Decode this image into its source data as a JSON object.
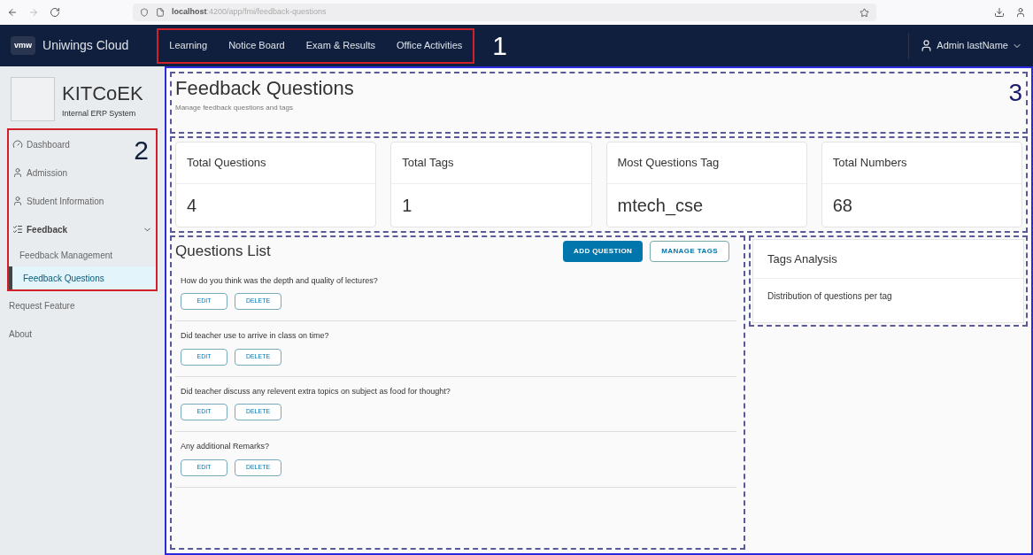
{
  "browser": {
    "url_host": "localhost",
    "url_path": ":4200/app/fmi/feedback-questions"
  },
  "header": {
    "logo": "vmw",
    "brand": "Uniwings Cloud",
    "nav": [
      {
        "label": "Learning"
      },
      {
        "label": "Notice Board"
      },
      {
        "label": "Exam & Results"
      },
      {
        "label": "Office Activities"
      }
    ],
    "user": "Admin lastName"
  },
  "annotations": [
    "1",
    "2",
    "3"
  ],
  "sidebar": {
    "org": "KITCoEK",
    "subtitle": "Internal ERP System",
    "items": [
      {
        "label": "Dashboard",
        "kind": "dashboard",
        "selected": false
      },
      {
        "label": "Admission",
        "kind": "person",
        "selected": false
      },
      {
        "label": "Student Information",
        "kind": "person",
        "selected": false
      },
      {
        "label": "Feedback",
        "kind": "group",
        "selected": false,
        "expanded": true,
        "children": [
          {
            "label": "Feedback Management",
            "selected": false
          },
          {
            "label": "Feedback Questions",
            "selected": true
          }
        ]
      },
      {
        "label": "Request Feature",
        "kind": "plain",
        "selected": false
      },
      {
        "label": "About",
        "kind": "plain",
        "selected": false
      }
    ]
  },
  "page": {
    "title": "Feedback Questions",
    "subtitle": "Manage feedback questions and tags"
  },
  "stats": [
    {
      "label": "Total Questions",
      "value": "4"
    },
    {
      "label": "Total Tags",
      "value": "1"
    },
    {
      "label": "Most Questions Tag",
      "value": "mtech_cse"
    },
    {
      "label": "Total Numbers",
      "value": "68"
    }
  ],
  "questions_list": {
    "title": "Questions List",
    "add_button": "ADD QUESTION",
    "manage_button": "MANAGE TAGS",
    "questions": [
      {
        "text": "How do you think was the depth and quality of lectures?",
        "edit": "EDIT",
        "delete": "DELETE"
      },
      {
        "text": "Did teacher use to arrive in class on time?",
        "edit": "EDIT",
        "delete": "DELETE"
      },
      {
        "text": "Did teacher discuss any relevent extra topics on subject as food for thought?",
        "edit": "EDIT",
        "delete": "DELETE"
      },
      {
        "text": "Any additional Remarks?",
        "edit": "EDIT",
        "delete": "DELETE"
      }
    ]
  },
  "tags_analysis": {
    "title": "Tags Analysis",
    "description": "Distribution of questions per tag"
  }
}
